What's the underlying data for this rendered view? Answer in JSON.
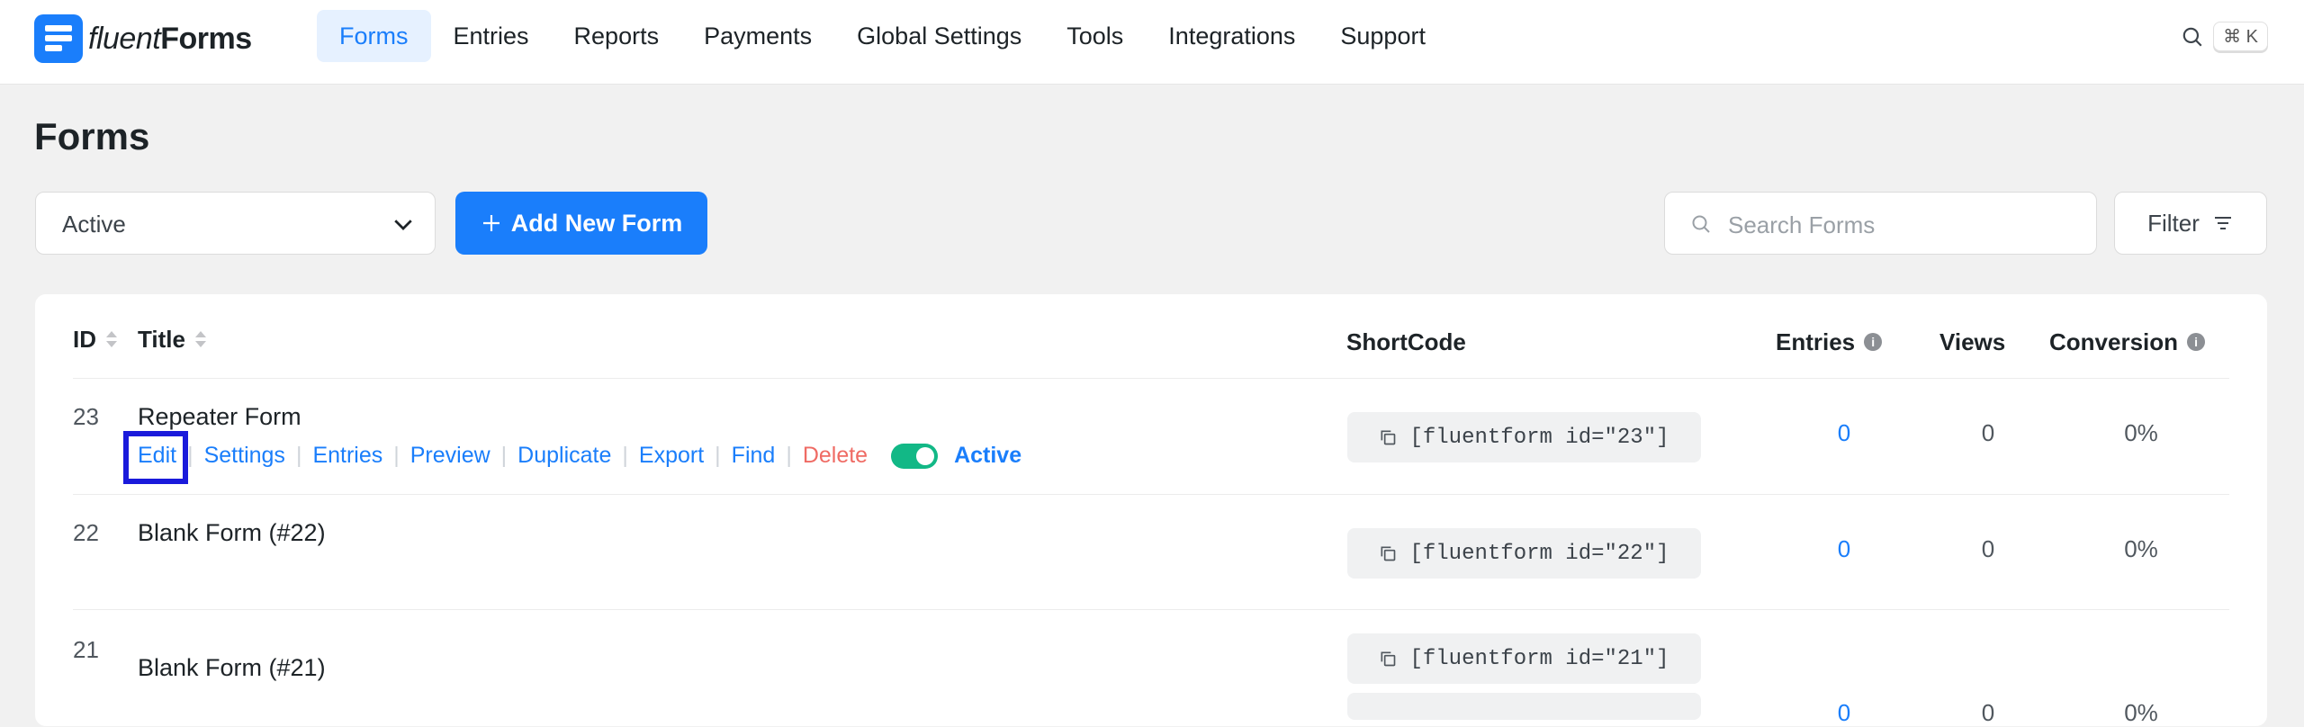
{
  "brand": {
    "name_regular": "fluent",
    "name_bold": "Forms"
  },
  "nav": {
    "items": [
      {
        "label": "Forms",
        "active": true
      },
      {
        "label": "Entries"
      },
      {
        "label": "Reports"
      },
      {
        "label": "Payments"
      },
      {
        "label": "Global Settings"
      },
      {
        "label": "Tools"
      },
      {
        "label": "Integrations"
      },
      {
        "label": "Support"
      }
    ],
    "search_shortcut": "⌘ K"
  },
  "page": {
    "title": "Forms",
    "status_filter": "Active",
    "add_button": "Add New Form",
    "search_placeholder": "Search Forms",
    "filter_button": "Filter"
  },
  "table": {
    "columns": {
      "id": "ID",
      "title": "Title",
      "shortcode": "ShortCode",
      "entries": "Entries",
      "views": "Views",
      "conversion": "Conversion"
    },
    "row_actions": {
      "edit": "Edit",
      "settings": "Settings",
      "entries": "Entries",
      "preview": "Preview",
      "duplicate": "Duplicate",
      "export": "Export",
      "find": "Find",
      "delete": "Delete",
      "status": "Active"
    },
    "rows": [
      {
        "id": "23",
        "title": "Repeater Form",
        "shortcode": "[fluentform id=\"23\"]",
        "entries": "0",
        "views": "0",
        "conversion": "0%"
      },
      {
        "id": "22",
        "title": "Blank Form (#22)",
        "shortcode": "[fluentform id=\"22\"]",
        "entries": "0",
        "views": "0",
        "conversion": "0%"
      },
      {
        "id": "21",
        "title": "Blank Form (#21)",
        "shortcode": "[fluentform id=\"21\"]",
        "entries": "0",
        "views": "0",
        "conversion": "0%"
      }
    ]
  },
  "colors": {
    "accent": "#1a7efb",
    "toggle_on": "#12b886",
    "danger": "#ef6b64",
    "highlight_box": "#1a1adb"
  }
}
